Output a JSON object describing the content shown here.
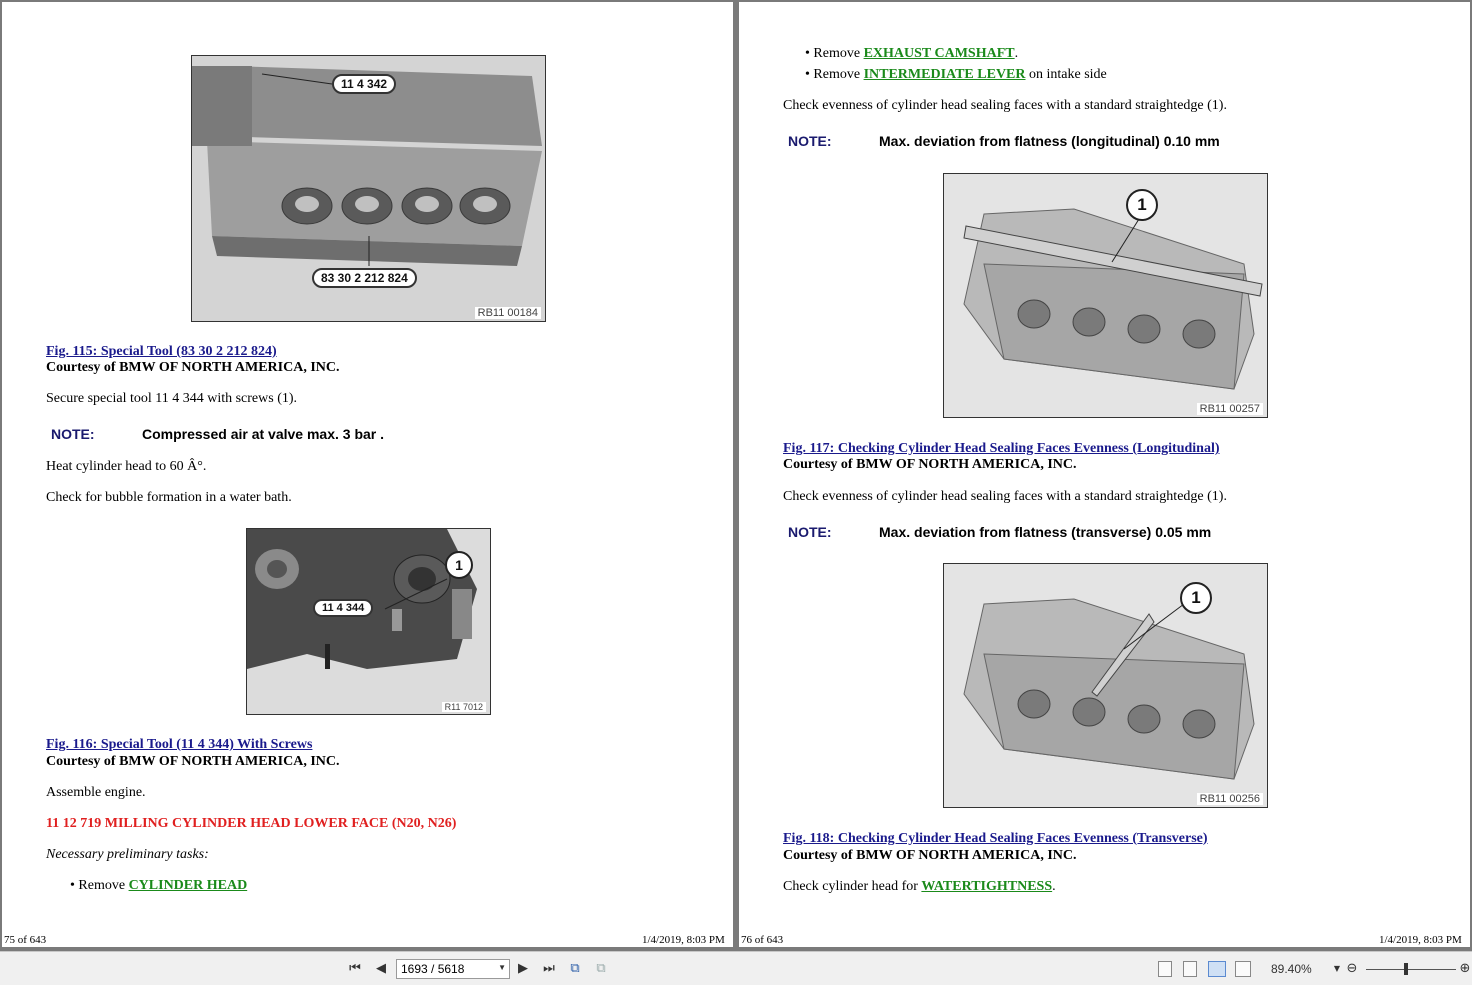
{
  "left_page": {
    "fig115": {
      "callout_top": "11 4 342",
      "callout_bottom": "83 30 2 212 824",
      "code": "RB11 00184",
      "caption": "Fig. 115: Special Tool (83 30 2 212 824)",
      "courtesy": "Courtesy of BMW OF NORTH AMERICA, INC."
    },
    "para1": "Secure special tool 11 4 344 with screws (1).",
    "note1_label": "NOTE:",
    "note1_text": "Compressed air at valve max. 3 bar .",
    "para2": "Heat cylinder head to 60 Â°.",
    "para3": "Check for bubble formation in a water bath.",
    "fig116": {
      "callout_label": "11 4 344",
      "callout_num": "1",
      "code": "R11 7012",
      "caption": "Fig. 116: Special Tool (11 4 344) With Screws",
      "courtesy": "Courtesy of BMW OF NORTH AMERICA, INC."
    },
    "para4": "Assemble engine.",
    "heading": "11 12 719 MILLING CYLINDER HEAD LOWER FACE (N20, N26)",
    "prelim": "Necessary preliminary tasks:",
    "bullet1_prefix": "Remove",
    "bullet1_link": "CYLINDER HEAD",
    "footer_left": "75 of 643",
    "footer_right": "1/4/2019, 8:03 PM"
  },
  "right_page": {
    "bullet1_prefix": "Remove",
    "bullet1_link": "EXHAUST CAMSHAFT",
    "bullet1_suffix": ".",
    "bullet2_prefix": "Remove",
    "bullet2_link": "INTERMEDIATE LEVER",
    "bullet2_suffix": "on intake side",
    "para1": "Check evenness of cylinder head sealing faces with a standard straightedge (1).",
    "note1_label": "NOTE:",
    "note1_text": "Max. deviation from flatness (longitudinal) 0.10 mm",
    "fig117": {
      "callout_num": "1",
      "code": "RB11 00257",
      "caption": "Fig. 117: Checking Cylinder Head Sealing Faces Evenness (Longitudinal)",
      "courtesy": "Courtesy of BMW OF NORTH AMERICA, INC."
    },
    "para2": "Check evenness of cylinder head sealing faces with a standard straightedge (1).",
    "note2_label": "NOTE:",
    "note2_text": "Max. deviation from flatness (transverse) 0.05 mm",
    "fig118": {
      "callout_num": "1",
      "code": "RB11 00256",
      "caption": "Fig. 118: Checking Cylinder Head Sealing Faces Evenness (Transverse)",
      "courtesy": "Courtesy of BMW OF NORTH AMERICA, INC."
    },
    "para3_prefix": "Check cylinder head for",
    "para3_link": "WATERTIGHTNESS",
    "para3_suffix": ".",
    "footer_left": "76 of 643",
    "footer_right": "1/4/2019, 8:03 PM"
  },
  "toolbar": {
    "page_display": "1693 / 5618",
    "zoom": "89.40%",
    "icons": [
      "first-page-icon",
      "prev-page-icon",
      "next-page-icon",
      "last-page-icon",
      "rotate-clockwise-icon",
      "rotate-counterclockwise-icon",
      "single-page-view-icon",
      "continuous-view-icon",
      "two-page-view-icon",
      "two-page-continuous-view-icon",
      "zoom-out-icon",
      "zoom-in-icon"
    ]
  }
}
